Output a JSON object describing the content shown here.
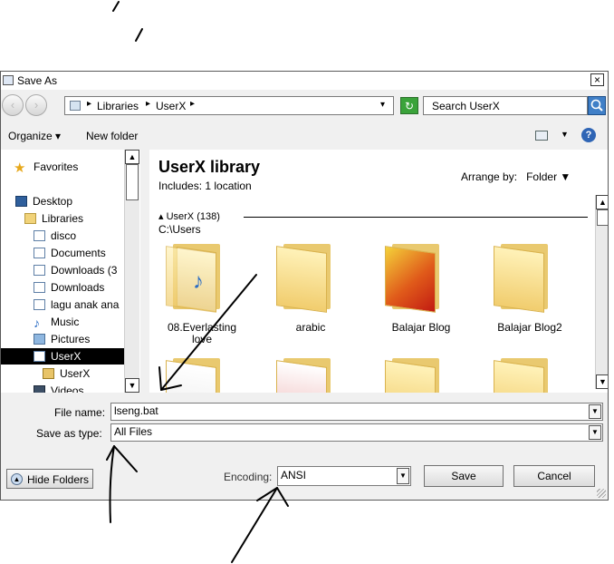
{
  "window": {
    "title": "Save As",
    "close_glyph": "×"
  },
  "nav": {
    "back_glyph": "‹",
    "forward_glyph": "›",
    "breadcrumb": [
      "Libraries",
      "UserX"
    ],
    "separator": "▸",
    "dropdown_glyph": "▾",
    "search_placeholder": "Search UserX",
    "refresh_glyph": "↻"
  },
  "toolbar": {
    "organize": "Organize ▾",
    "new_folder": "New folder",
    "view_arrow": "▼",
    "help": "?"
  },
  "sidebar": {
    "favorites": "Favorites",
    "items": [
      {
        "label": "Desktop",
        "icon": "desktop-icon"
      },
      {
        "label": "Libraries",
        "icon": "libraries-icon"
      },
      {
        "label": "disco",
        "icon": "document-icon"
      },
      {
        "label": "Documents",
        "icon": "document-icon"
      },
      {
        "label": "Downloads (3",
        "icon": "document-icon"
      },
      {
        "label": "Downloads",
        "icon": "document-icon"
      },
      {
        "label": "lagu anak ana",
        "icon": "document-icon"
      },
      {
        "label": "Music",
        "icon": "music-icon"
      },
      {
        "label": "Pictures",
        "icon": "pictures-icon"
      },
      {
        "label": "UserX",
        "icon": "document-icon",
        "selected": true
      },
      {
        "label": "UserX",
        "icon": "user-lock-icon"
      },
      {
        "label": "Videos",
        "icon": "videos-icon"
      }
    ]
  },
  "content": {
    "library_title": "UserX library",
    "includes": "Includes:  1 location",
    "arrange_label": "Arrange by:",
    "arrange_value": "Folder ▼",
    "group_header": "UserX (138)",
    "group_path": "C:\\Users",
    "folders": [
      {
        "label": "08.Everlasting love",
        "kind": "music-folder"
      },
      {
        "label": "arabic",
        "kind": "folder"
      },
      {
        "label": "Balajar Blog",
        "kind": "image-folder"
      },
      {
        "label": "Balajar Blog2",
        "kind": "folder"
      }
    ]
  },
  "form": {
    "file_name_label": "File name:",
    "file_name_value": "lseng.bat",
    "save_type_label": "Save as type:",
    "save_type_value": "All Files",
    "encoding_label": "Encoding:",
    "encoding_value": "ANSI"
  },
  "buttons": {
    "hide_folders": "Hide Folders",
    "save": "Save",
    "cancel": "Cancel",
    "hide_glyph": "▲"
  },
  "scroll_glyphs": {
    "up": "▲",
    "down": "▼"
  }
}
